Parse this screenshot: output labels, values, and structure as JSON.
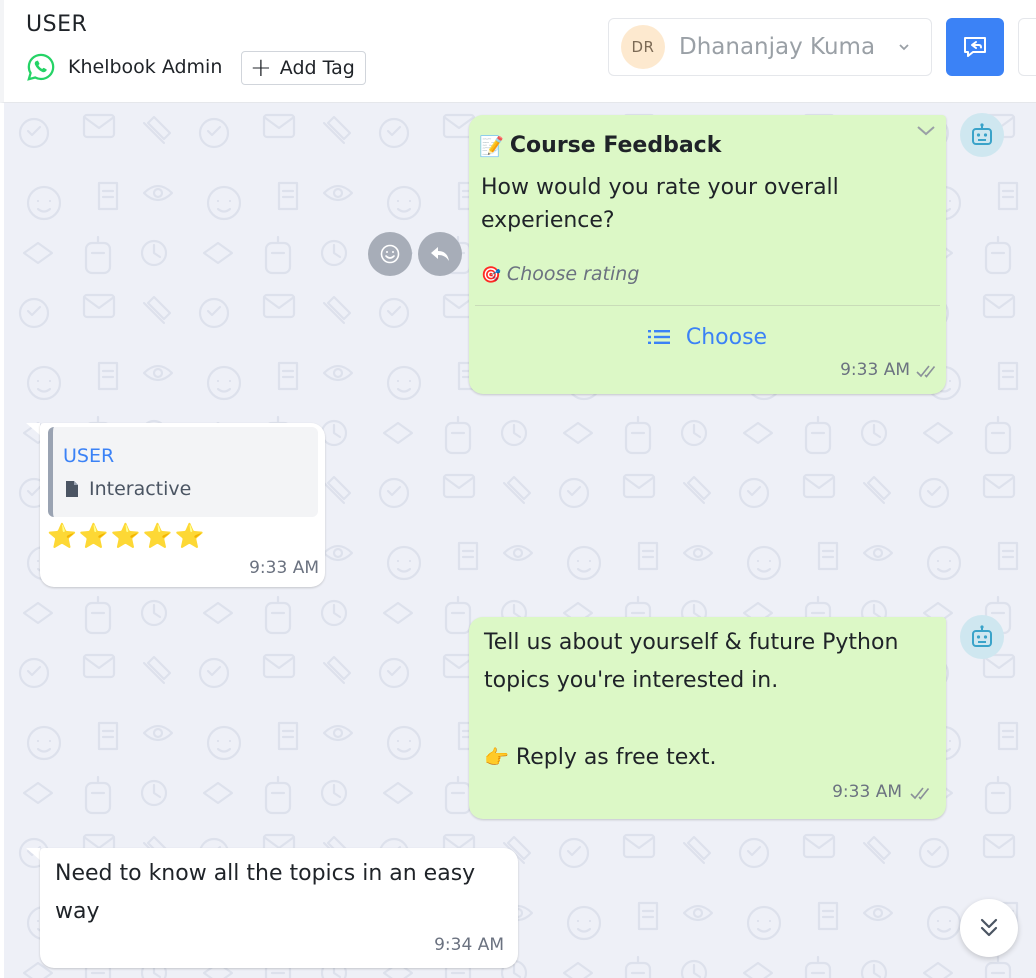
{
  "header": {
    "title": "USER",
    "channel_icon": "whatsapp-icon",
    "account_name": "Khelbook Admin",
    "add_tag_label": "Add Tag",
    "assignee": {
      "initials": "DR",
      "name": "Dhananjay Kuma"
    },
    "colors": {
      "primary": "#3b82f6",
      "whatsapp": "#25d366"
    }
  },
  "messages": [
    {
      "direction": "outgoing",
      "title_emoji": "📝",
      "title": "Course Feedback",
      "body": "How would you rate your overall experience?",
      "hint_emoji": "🎯",
      "hint": "Choose rating",
      "button_label": "Choose",
      "time": "9:33 AM",
      "status": "delivered"
    },
    {
      "direction": "incoming",
      "quote_author": "USER",
      "quote_type": "Interactive",
      "body": "⭐⭐⭐⭐⭐",
      "time": "9:33 AM"
    },
    {
      "direction": "outgoing",
      "body_line1": "Tell us about yourself & future Python topics you're interested in.",
      "body_line2_emoji": "👉",
      "body_line2": "Reply as free text.",
      "time": "9:33 AM",
      "status": "delivered"
    },
    {
      "direction": "incoming",
      "body": "Need to know all the topics in an easy way",
      "time": "9:34 AM"
    }
  ],
  "colors": {
    "outgoing_bubble": "#dcf8c6",
    "incoming_bubble": "#ffffff",
    "chat_background": "#eef0f7"
  }
}
